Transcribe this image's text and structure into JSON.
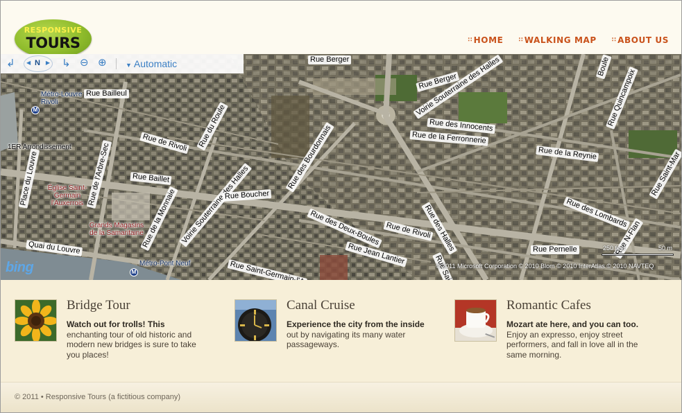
{
  "logo": {
    "line1": "RESPONSIVE",
    "line2": "TOURS"
  },
  "nav": [
    {
      "label": "HOME",
      "icon": "grid-bullet-icon"
    },
    {
      "label": "WALKING MAP",
      "icon": "grid-bullet-icon"
    },
    {
      "label": "ABOUT US",
      "icon": "grid-bullet-icon"
    }
  ],
  "map": {
    "toolbar": {
      "compass_label": "N",
      "mode_label": "Automatic"
    },
    "streets": [
      "Rue Berger",
      "Rue Bailleul",
      "Rue Berger",
      "Voirie Souterraine des Halles",
      "Rue des Innocents",
      "Rue de la Ferronnerie",
      "Boule",
      "Rue Quincampoix",
      "Rue de Rivoli",
      "Rue du Roule",
      "Rue de l'Arbre-Sec",
      "Rue Baillet",
      "Rue des Bourdonnais",
      "Rue de la Reynie",
      "Rue Saint-Mar",
      "Place du Louvre",
      "Voirie Souterraine des Halles",
      "Rue Boucher",
      "Rue de la Monnaie",
      "Rue des Lombards",
      "Rue des Deux-Boules",
      "Rue de Rivoli",
      "Rue des Halles",
      "Quai du Louvre",
      "Rue Jean Lantier",
      "Rue Pernelle",
      "Rue Saint-Denis",
      "Rue Saint-Germain-l'A",
      "Rue N-Flan"
    ],
    "metro_labels": [
      "Métro-Louvre Rivoli",
      "Métro-Pont Neuf"
    ],
    "arrondissement": "1ER Arrondissement",
    "pois": [
      "Église Saint-Germain l'Auxerrois",
      "Grands Magasins de la Samaritaine"
    ],
    "brand": "bing",
    "copyright": "© 2011 Microsoft Corporation   © 2010 Blom  © 2010 InterAtlas © 2010 NAVTEQ",
    "scale_ft": "250 feet",
    "scale_m": "50 m"
  },
  "features": [
    {
      "title": "Bridge Tour",
      "lead": "Watch out for trolls! This",
      "body": "enchanting tour of old historic and modern new bridges is sure to take you places!",
      "image": "sunflower-photo"
    },
    {
      "title": "Canal Cruise",
      "lead": "Experience the city from the inside",
      "body": "out by navigating its many water passageways.",
      "image": "clock-photo"
    },
    {
      "title": "Romantic Cafes",
      "lead": "Mozart ate here, and you can too.",
      "body": "Enjoy an expresso, enjoy street performers, and fall in love all in the same morning.",
      "image": "coffee-cup-photo"
    }
  ],
  "footer": {
    "text": "© 2011 • Responsive Tours (a fictitious company)"
  },
  "colors": {
    "nav": "#c9521b",
    "background": "#fdf8ea",
    "logo_green": "#8fbc2c",
    "map_link": "#3b7fc4"
  }
}
